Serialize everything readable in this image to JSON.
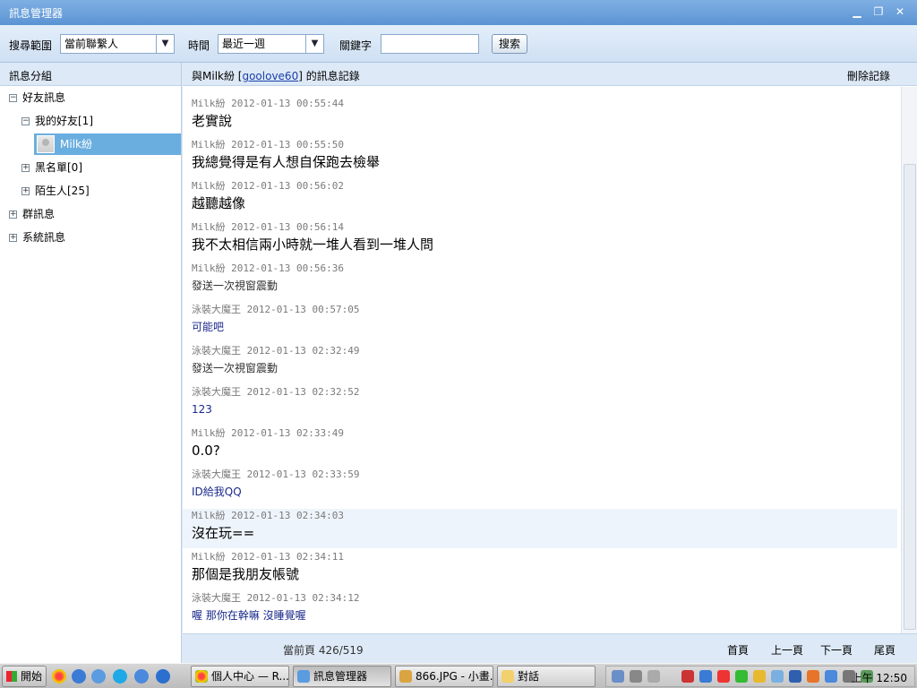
{
  "window": {
    "title": "訊息管理器"
  },
  "search": {
    "range_label": "搜尋範圍",
    "range_value": "當前聯繫人",
    "time_label": "時間",
    "time_value": "最近一週",
    "keyword_label": "關鍵字",
    "keyword_value": "",
    "search_button": "搜索"
  },
  "sidebar": {
    "header": "訊息分組",
    "tree": [
      {
        "label": "好友訊息",
        "expander": "−"
      },
      {
        "label": "我的好友[1]",
        "expander": "−"
      },
      {
        "label": "Milk紛",
        "expander": ""
      },
      {
        "label": "黑名單[0]",
        "expander": "+"
      },
      {
        "label": "陌生人[25]",
        "expander": "+"
      },
      {
        "label": "群訊息",
        "expander": "+"
      },
      {
        "label": "系統訊息",
        "expander": "+"
      }
    ]
  },
  "main": {
    "header_prefix": "與Milk紛 [",
    "header_link": "goolove60",
    "header_suffix": "] 的訊息記錄",
    "delete_label": "刪除記錄",
    "messages": [
      {
        "sender": "Milk紛",
        "time": "2012-01-13 00:55:44",
        "text": "老實說"
      },
      {
        "sender": "Milk紛",
        "time": "2012-01-13 00:55:50",
        "text": "我總覺得是有人想自保跑去檢舉"
      },
      {
        "sender": "Milk紛",
        "time": "2012-01-13 00:56:02",
        "text": "越聽越像"
      },
      {
        "sender": "Milk紛",
        "time": "2012-01-13 00:56:14",
        "text": "我不太相信兩小時就一堆人看到一堆人問"
      },
      {
        "sender": "Milk紛",
        "time": "2012-01-13 00:56:36",
        "text": "發送一次視窗震動"
      },
      {
        "sender": "泳裝大魔王",
        "time": "2012-01-13 00:57:05",
        "text": "可能吧"
      },
      {
        "sender": "泳裝大魔王",
        "time": "2012-01-13 02:32:49",
        "text": "發送一次視窗震動"
      },
      {
        "sender": "泳裝大魔王",
        "time": "2012-01-13 02:32:52",
        "text": "123"
      },
      {
        "sender": "Milk紛",
        "time": "2012-01-13 02:33:49",
        "text": "0.0?"
      },
      {
        "sender": "泳裝大魔王",
        "time": "2012-01-13 02:33:59",
        "text": "ID給我QQ"
      },
      {
        "sender": "Milk紛",
        "time": "2012-01-13 02:34:03",
        "text": "沒在玩=="
      },
      {
        "sender": "Milk紛",
        "time": "2012-01-13 02:34:11",
        "text": "那個是我朋友帳號"
      },
      {
        "sender": "泳裝大魔王",
        "time": "2012-01-13 02:34:12",
        "text": "喔 那你在幹嘛 沒睡覺喔"
      }
    ]
  },
  "footer": {
    "page_info": "當前頁 426/519",
    "first": "首頁",
    "prev": "上一頁",
    "next": "下一頁",
    "last": "尾頁"
  },
  "taskbar": {
    "start": "開始",
    "tasks": [
      "個人中心 — R...",
      "訊息管理器",
      "866.JPG - 小畫...",
      "對話"
    ],
    "clock": "上午 12:50"
  }
}
